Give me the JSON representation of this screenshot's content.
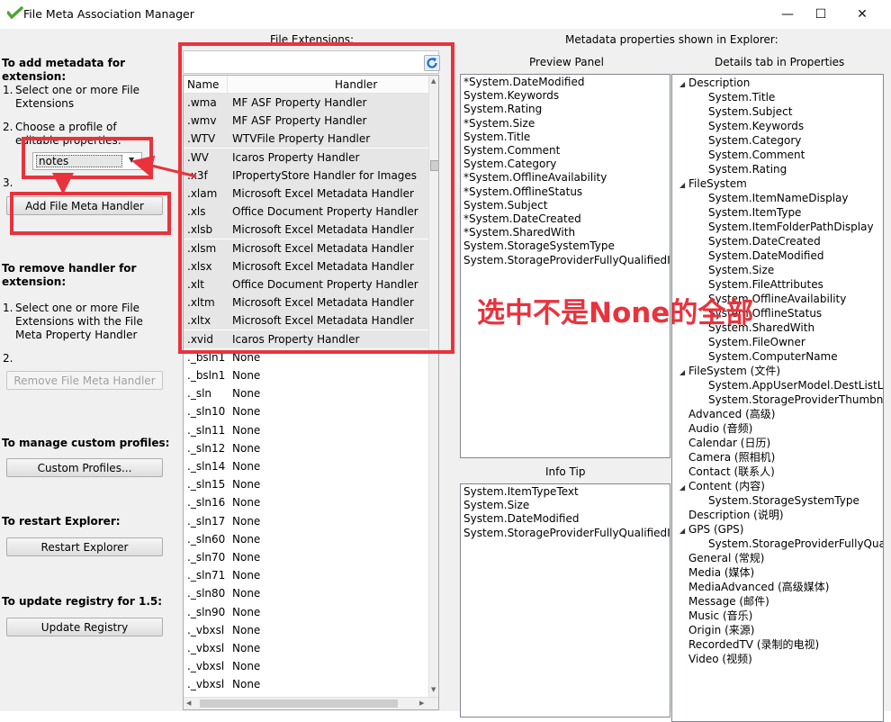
{
  "window": {
    "title": "File Meta Association Manager",
    "controls": {
      "minimize": "—",
      "maximize": "☐",
      "close": "✕"
    }
  },
  "left": {
    "add_section": {
      "heading": "To add metadata for extension:",
      "step1_num": "1.",
      "step1_text": "Select one or more File Extensions",
      "step2_num": "2.",
      "step2_text": "Choose a profile of editable properties:",
      "profile_value": "notes",
      "step3_num": "3.",
      "add_button": "Add File Meta Handler"
    },
    "remove_section": {
      "heading": "To remove handler for extension:",
      "step1_num": "1.",
      "step1_text": "Select one or more File Extensions with the File Meta Property Handler",
      "step2_num": "2.",
      "remove_button": "Remove File Meta Handler"
    },
    "profiles": {
      "heading": "To manage custom profiles:",
      "button": "Custom Profiles..."
    },
    "restart": {
      "heading": "To restart Explorer:",
      "button": "Restart Explorer"
    },
    "registry": {
      "heading": "To update registry for 1.5:",
      "button": "Update Registry"
    }
  },
  "extensions": {
    "label": "File Extensions:",
    "columns": {
      "name": "Name",
      "handler": "Handler"
    },
    "rows": [
      {
        "ext": ".wma",
        "handler": "MF ASF Property Handler",
        "selected": true
      },
      {
        "ext": ".wmv",
        "handler": "MF ASF Property Handler",
        "selected": true
      },
      {
        "ext": ".WTV",
        "handler": "WTVFile Property Handler",
        "selected": true
      },
      {
        "ext": ".WV",
        "handler": "Icaros Property Handler",
        "selected": true
      },
      {
        "ext": ".x3f",
        "handler": "IPropertyStore Handler for Images",
        "selected": true
      },
      {
        "ext": ".xlam",
        "handler": "Microsoft Excel Metadata Handler",
        "selected": true
      },
      {
        "ext": ".xls",
        "handler": "Office Document Property Handler",
        "selected": true
      },
      {
        "ext": ".xlsb",
        "handler": "Microsoft Excel Metadata Handler",
        "selected": true
      },
      {
        "ext": ".xlsm",
        "handler": "Microsoft Excel Metadata Handler",
        "selected": true
      },
      {
        "ext": ".xlsx",
        "handler": "Microsoft Excel Metadata Handler",
        "selected": true
      },
      {
        "ext": ".xlt",
        "handler": "Office Document Property Handler",
        "selected": true
      },
      {
        "ext": ".xltm",
        "handler": "Microsoft Excel Metadata Handler",
        "selected": true
      },
      {
        "ext": ".xltx",
        "handler": "Microsoft Excel Metadata Handler",
        "selected": true
      },
      {
        "ext": ".xvid",
        "handler": "Icaros Property Handler",
        "selected": true
      },
      {
        "ext": "._bsln1",
        "handler": "None",
        "selected": false
      },
      {
        "ext": "._bsln1",
        "handler": "None",
        "selected": false
      },
      {
        "ext": "._sln",
        "handler": "None",
        "selected": false
      },
      {
        "ext": "._sln10",
        "handler": "None",
        "selected": false
      },
      {
        "ext": "._sln11",
        "handler": "None",
        "selected": false
      },
      {
        "ext": "._sln12",
        "handler": "None",
        "selected": false
      },
      {
        "ext": "._sln14",
        "handler": "None",
        "selected": false
      },
      {
        "ext": "._sln15",
        "handler": "None",
        "selected": false
      },
      {
        "ext": "._sln16",
        "handler": "None",
        "selected": false
      },
      {
        "ext": "._sln17",
        "handler": "None",
        "selected": false
      },
      {
        "ext": "._sln60",
        "handler": "None",
        "selected": false
      },
      {
        "ext": "._sln70",
        "handler": "None",
        "selected": false
      },
      {
        "ext": "._sln71",
        "handler": "None",
        "selected": false
      },
      {
        "ext": "._sln80",
        "handler": "None",
        "selected": false
      },
      {
        "ext": "._sln90",
        "handler": "None",
        "selected": false
      },
      {
        "ext": "._vbxsl",
        "handler": "None",
        "selected": false
      },
      {
        "ext": "._vbxsl",
        "handler": "None",
        "selected": false
      },
      {
        "ext": "._vbxsl",
        "handler": "None",
        "selected": false
      },
      {
        "ext": "._vbxsl",
        "handler": "None",
        "selected": false
      }
    ]
  },
  "metadata": {
    "label": "Metadata properties shown in Explorer:",
    "preview_panel": {
      "title": "Preview Panel",
      "items": [
        "*System.DateModified",
        "System.Keywords",
        "System.Rating",
        "*System.Size",
        "System.Title",
        "System.Comment",
        "System.Category",
        "*System.OfflineAvailability",
        "*System.OfflineStatus",
        "System.Subject",
        "*System.DateCreated",
        "*System.SharedWith",
        "System.StorageSystemType",
        "System.StorageProviderFullyQualifiedId"
      ]
    },
    "info_tip": {
      "title": "Info Tip",
      "items": [
        "System.ItemTypeText",
        "System.Size",
        "System.DateModified",
        "System.StorageProviderFullyQualifiedId"
      ]
    },
    "details_tab": {
      "title": "Details tab in Properties",
      "items": [
        {
          "text": "Description",
          "level": 0,
          "expander": true
        },
        {
          "text": "System.Title",
          "level": 1
        },
        {
          "text": "System.Subject",
          "level": 1
        },
        {
          "text": "System.Keywords",
          "level": 1
        },
        {
          "text": "System.Category",
          "level": 1
        },
        {
          "text": "System.Comment",
          "level": 1
        },
        {
          "text": "System.Rating",
          "level": 1
        },
        {
          "text": "FileSystem",
          "level": 0,
          "expander": true
        },
        {
          "text": "System.ItemNameDisplay",
          "level": 1
        },
        {
          "text": "System.ItemType",
          "level": 1
        },
        {
          "text": "System.ItemFolderPathDisplay",
          "level": 1
        },
        {
          "text": "System.DateCreated",
          "level": 1
        },
        {
          "text": "System.DateModified",
          "level": 1
        },
        {
          "text": "System.Size",
          "level": 1
        },
        {
          "text": "System.FileAttributes",
          "level": 1
        },
        {
          "text": "System.OfflineAvailability",
          "level": 1
        },
        {
          "text": "System.OfflineStatus",
          "level": 1
        },
        {
          "text": "System.SharedWith",
          "level": 1
        },
        {
          "text": "System.FileOwner",
          "level": 1
        },
        {
          "text": "System.ComputerName",
          "level": 1
        },
        {
          "text": "FileSystem (文件)",
          "level": 0,
          "expander": true
        },
        {
          "text": "System.AppUserModel.DestListLo",
          "level": 1
        },
        {
          "text": "System.StorageProviderThumbna",
          "level": 1
        },
        {
          "text": "Advanced (高级)",
          "level": 0,
          "expander": false
        },
        {
          "text": "Audio (音频)",
          "level": 0,
          "expander": false
        },
        {
          "text": "Calendar (日历)",
          "level": 0,
          "expander": false
        },
        {
          "text": "Camera (照相机)",
          "level": 0,
          "expander": false
        },
        {
          "text": "Contact (联系人)",
          "level": 0,
          "expander": false
        },
        {
          "text": "Content (内容)",
          "level": 0,
          "expander": true
        },
        {
          "text": "System.StorageSystemType",
          "level": 1
        },
        {
          "text": "Description (说明)",
          "level": 0,
          "expander": false
        },
        {
          "text": "GPS (GPS)",
          "level": 0,
          "expander": true
        },
        {
          "text": "System.StorageProviderFullyQual",
          "level": 1
        },
        {
          "text": "General (常规)",
          "level": 0,
          "expander": false
        },
        {
          "text": "Media (媒体)",
          "level": 0,
          "expander": false
        },
        {
          "text": "MediaAdvanced (高级媒体)",
          "level": 0,
          "expander": false
        },
        {
          "text": "Message (邮件)",
          "level": 0,
          "expander": false
        },
        {
          "text": "Music (音乐)",
          "level": 0,
          "expander": false
        },
        {
          "text": "Origin (来源)",
          "level": 0,
          "expander": false
        },
        {
          "text": "RecordedTV (录制的电视)",
          "level": 0,
          "expander": false
        },
        {
          "text": "Video (视频)",
          "level": 0,
          "expander": false
        }
      ]
    }
  },
  "annotation": {
    "text": "选中不是None的全部",
    "color": "#e8333d"
  },
  "colors": {
    "accent_red": "#e8333d",
    "refresh_blue": "#1e6fd0",
    "selected_row": "#e6e6e6"
  }
}
